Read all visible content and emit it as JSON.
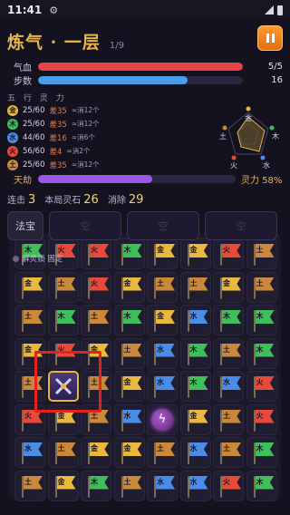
{
  "status_bar": {
    "time": "11:41",
    "settings_icon": "gear-icon"
  },
  "header": {
    "title": "炼气 · 一层",
    "progress": "1/9",
    "pause_icon": "pause-icon"
  },
  "bars": {
    "hp": {
      "label": "气血",
      "value_text": "5/5",
      "fraction": 1.0,
      "color": "#e8434a"
    },
    "steps": {
      "label": "步数",
      "value_text": "16",
      "fraction": 0.73,
      "color": "#4a9de8"
    }
  },
  "five_elements": {
    "label": "五 行 灵 力",
    "items": [
      {
        "badge": "金",
        "count": "25/60",
        "lack": "差35",
        "note": "≈消12个",
        "color": "#e8b93c"
      },
      {
        "badge": "木",
        "count": "25/60",
        "lack": "差35",
        "note": "≈消12个",
        "color": "#3fbf5a"
      },
      {
        "badge": "水",
        "count": "44/60",
        "lack": "差16",
        "note": "≈消6个",
        "color": "#4a8de8"
      },
      {
        "badge": "火",
        "count": "56/60",
        "lack": "差4",
        "note": "≈消2个",
        "color": "#e84a3a"
      },
      {
        "badge": "土",
        "count": "25/60",
        "lack": "差35",
        "note": "≈消12个",
        "color": "#c9883a"
      }
    ]
  },
  "radar": {
    "labels": [
      "金",
      "木",
      "水",
      "火",
      "土"
    ]
  },
  "tribulation": {
    "label": "天劫",
    "rate_text": "灵力 58%",
    "fraction": 0.58,
    "color": "#9a58e8"
  },
  "stats": [
    {
      "label": "连击",
      "value": "3"
    },
    {
      "label": "本局灵石",
      "value": "26"
    },
    {
      "label": "消除",
      "value": "29"
    }
  ],
  "treasure": {
    "main_label": "法宝",
    "slot_glyph": "空"
  },
  "lock_tip": "解灵锁 固定",
  "board": {
    "rows": [
      [
        "木",
        "火",
        "火",
        "木",
        "金",
        "金",
        "火",
        "土"
      ],
      [
        "金",
        "土",
        "火",
        "金",
        "土",
        "土",
        "金",
        "土"
      ],
      [
        "土",
        "木",
        "土",
        "木",
        "金",
        "水",
        "木",
        "木"
      ],
      [
        "金",
        "火",
        "金",
        "土",
        "水",
        "木",
        "土",
        "木"
      ],
      [
        "土",
        "X",
        "土",
        "金",
        "水",
        "木",
        "水",
        "火"
      ],
      [
        "火",
        "金",
        "土",
        "水",
        "O",
        "金",
        "土",
        "火"
      ],
      [
        "水",
        "土",
        "金",
        "金",
        "土",
        "水",
        "土",
        "木"
      ],
      [
        "土",
        "金",
        "木",
        "土",
        "水",
        "水",
        "火",
        "木"
      ]
    ],
    "colors": {
      "金": "#e8b93c",
      "木": "#3fbf5a",
      "水": "#4a8de8",
      "火": "#e84a3a",
      "土": "#c9883a"
    },
    "special_x_icon": "crossed-swords-icon",
    "special_orb_icon": "lightning-orb-icon"
  }
}
